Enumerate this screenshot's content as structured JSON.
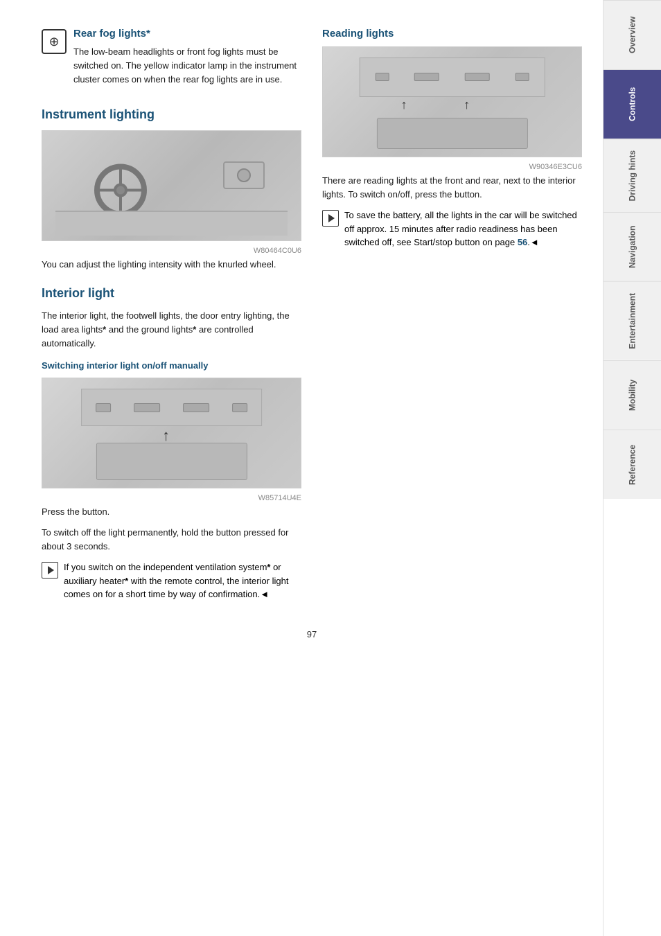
{
  "sidebar": {
    "items": [
      {
        "label": "Overview",
        "active": false
      },
      {
        "label": "Controls",
        "active": true
      },
      {
        "label": "Driving hints",
        "active": false
      },
      {
        "label": "Navigation",
        "active": false
      },
      {
        "label": "Entertainment",
        "active": false
      },
      {
        "label": "Mobility",
        "active": false
      },
      {
        "label": "Reference",
        "active": false
      }
    ]
  },
  "page": {
    "number": "97"
  },
  "rear_fog": {
    "heading": "Rear fog lights*",
    "text": "The low-beam headlights or front fog lights must be switched on. The yellow indicator lamp in the instrument cluster comes on when the rear fog lights are in use."
  },
  "instrument_lighting": {
    "heading": "Instrument lighting",
    "body": "You can adjust the lighting intensity with the knurled wheel.",
    "image_caption": "W80464C0U6"
  },
  "interior_light": {
    "heading": "Interior light",
    "body": "The interior light, the footwell lights, the door entry lighting, the load area lights* and the ground lights* are controlled automatically.",
    "sub_heading": "Switching interior light on/off manually",
    "press_button": "Press the button.",
    "hold_text": "To switch off the light permanently, hold the button pressed for about 3 seconds.",
    "note_text": "If you switch on the independent ventilation system* or auxiliary heater* with the remote control, the interior light comes on for a short time by way of confirmation.◄",
    "image_caption": "W85714U4E"
  },
  "reading_lights": {
    "heading": "Reading lights",
    "body": "There are reading lights at the front and rear, next to the interior lights. To switch on/off, press the button.",
    "note_text": "To save the battery, all the lights in the car will be switched off approx. 15 minutes after radio readiness has been switched off, see Start/stop button on page 56.◄",
    "page_link": "56",
    "image_caption": "W90346E3CU6"
  }
}
